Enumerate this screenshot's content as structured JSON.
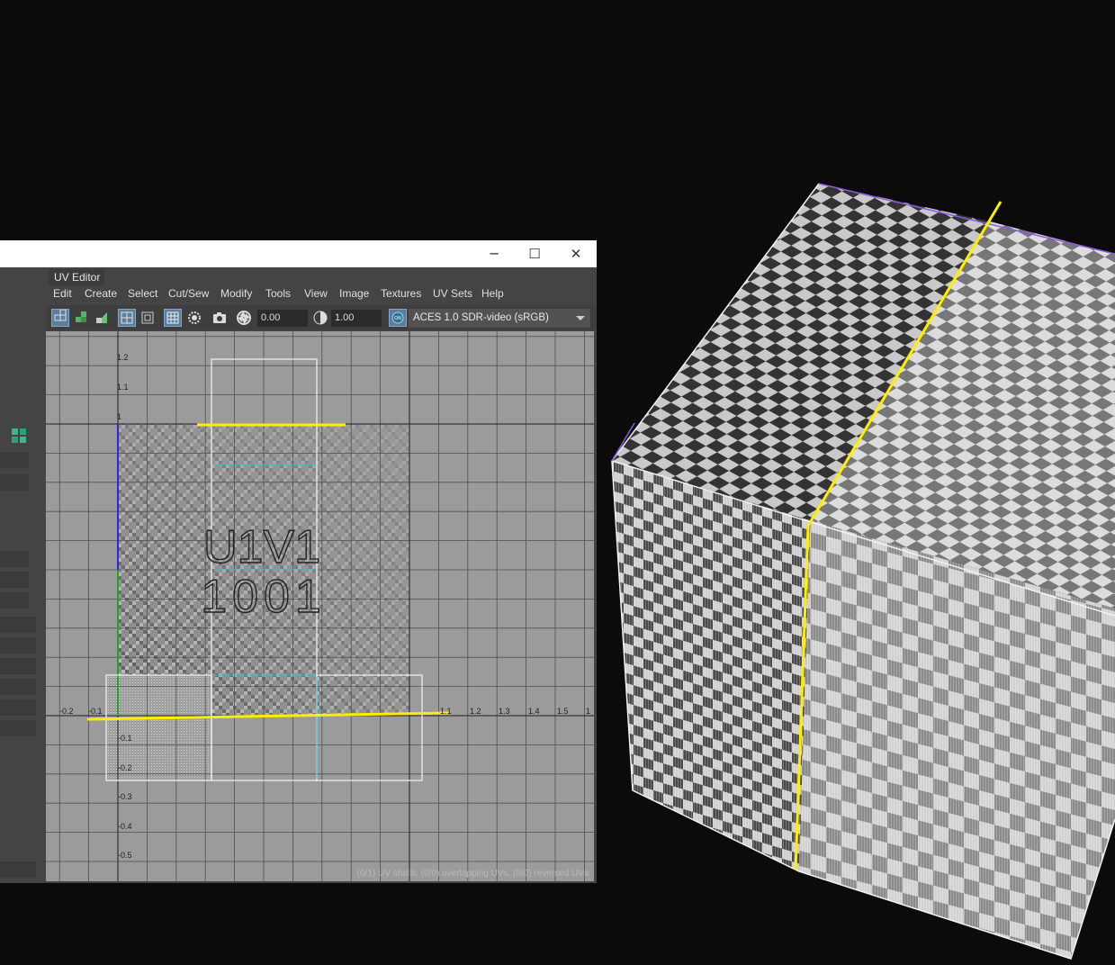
{
  "window": {
    "minimize_glyph": "─",
    "maximize_glyph": "☐",
    "close_glyph": "✕"
  },
  "panel_title": "UV Editor",
  "menu": [
    "Edit",
    "Create",
    "Select",
    "Cut/Sew",
    "Modify",
    "Tools",
    "View",
    "Image",
    "Textures",
    "UV Sets",
    "Help"
  ],
  "toolbar": {
    "exposure": "0.00",
    "gamma": "1.00",
    "color_space": "ACES 1.0 SDR-video (sRGB)",
    "icons": [
      "uv-shell-icon",
      "component-icon",
      "shaded-icon",
      "grid-toggle-icon",
      "tile-icon",
      "checker-icon",
      "pivot-icon",
      "snapshot-icon",
      "aperture-icon",
      "contrast-icon",
      "color-mgmt-icon"
    ]
  },
  "uv_grid": {
    "x_ticks": [
      "-0.2",
      "-0.1",
      "1.1",
      "1.2",
      "1.3",
      "1.4",
      "1.5",
      "1"
    ],
    "y_ticks_top": [
      "1.2",
      "1.1",
      "1"
    ],
    "y_ticks_bottom": [
      "-0.1",
      "-0.2",
      "-0.3",
      "-0.4",
      "-0.5"
    ],
    "tile_label_line1": "U1V1",
    "tile_label_line2": "1001"
  },
  "status": "(0/1) UV shells, (0/0) overlapping UVs, (0/0) reversed UVs",
  "colors": {
    "accent_yellow": "#ffee00",
    "panel_bg": "#444444",
    "grid_bg": "#9b9b9b",
    "highlight_blue": "#4a90c8"
  }
}
